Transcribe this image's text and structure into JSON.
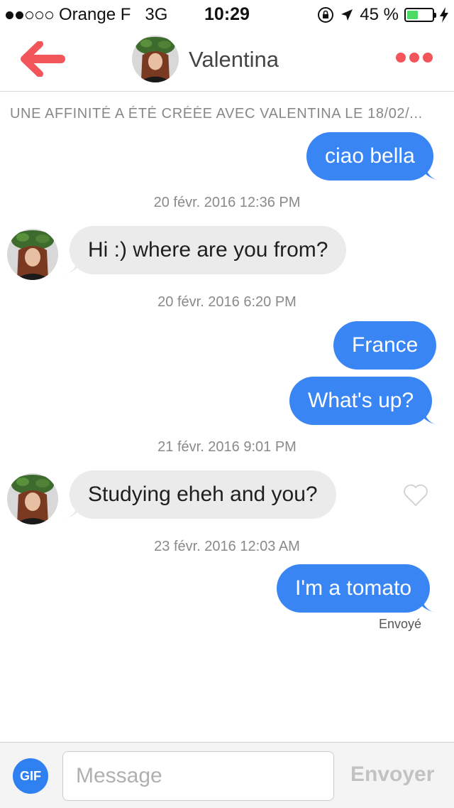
{
  "status_bar": {
    "carrier": "Orange F",
    "network": "3G",
    "time": "10:29",
    "battery_percent": "45 %",
    "battery_level": 0.45,
    "icons": [
      "signal-dots-icon",
      "rotation-lock-icon",
      "location-arrow-icon",
      "battery-icon",
      "charging-bolt-icon"
    ]
  },
  "nav": {
    "title": "Valentina",
    "back_icon": "back-arrow-icon",
    "more_icon": "more-dots-icon",
    "accent_color": "#f2565a"
  },
  "chat": {
    "match_banner": "UNE AFFINITÉ A ÉTÉ CRÉÉE AVEC VALENTINA LE 18/02/...",
    "messages": [
      {
        "text": "ciao bella",
        "direction": "out"
      },
      {
        "timestamp": "20 févr. 2016 12:36 PM"
      },
      {
        "text": "Hi :) where are you from?",
        "direction": "in"
      },
      {
        "timestamp": "20 févr. 2016 6:20 PM"
      },
      {
        "text": "France",
        "direction": "out"
      },
      {
        "text": "What's up?",
        "direction": "out"
      },
      {
        "timestamp": "21 févr. 2016 9:01 PM"
      },
      {
        "text": "Studying eheh and you?",
        "direction": "in"
      },
      {
        "timestamp": "23 févr. 2016 12:03 AM"
      },
      {
        "text": "I'm a tomato",
        "direction": "out"
      }
    ],
    "sent_status": "Envoyé",
    "outgoing_color": "#3a85f4",
    "incoming_color": "#ebebeb"
  },
  "composer": {
    "gif_label": "GIF",
    "placeholder": "Message",
    "value": "",
    "send_label": "Envoyer"
  }
}
